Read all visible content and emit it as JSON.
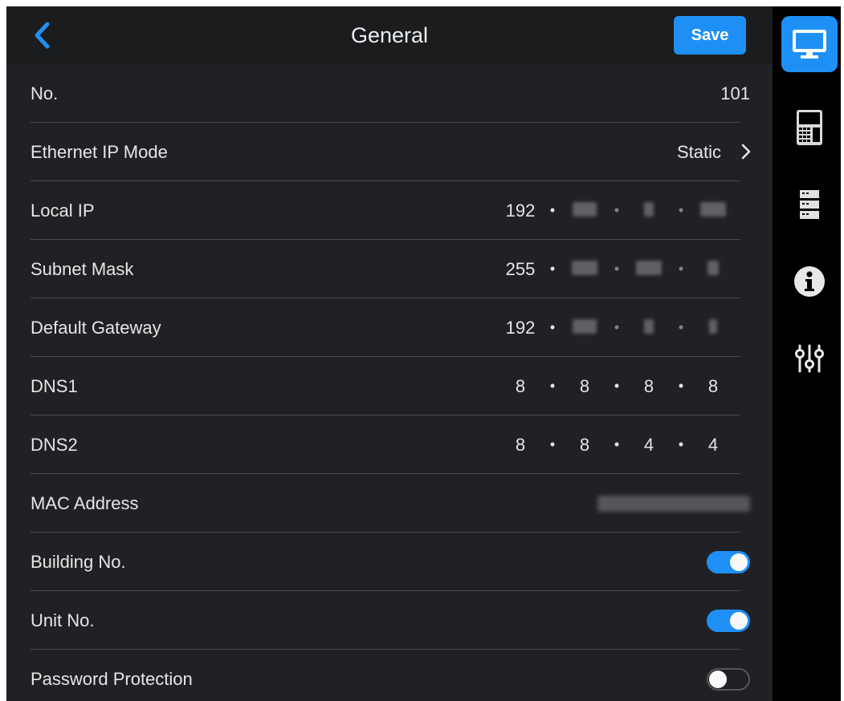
{
  "header": {
    "title": "General",
    "back_icon": "chevron-left-icon",
    "save_label": "Save"
  },
  "rows": {
    "number": {
      "label": "No.",
      "value": "101"
    },
    "ip_mode": {
      "label": "Ethernet IP Mode",
      "value": "Static"
    },
    "local_ip": {
      "label": "Local IP",
      "first_octet": "192"
    },
    "subnet_mask": {
      "label": "Subnet Mask",
      "first_octet": "255"
    },
    "gateway": {
      "label": "Default Gateway",
      "first_octet": "192"
    },
    "dns1": {
      "label": "DNS1",
      "octets": [
        "8",
        "8",
        "8",
        "8"
      ]
    },
    "dns2": {
      "label": "DNS2",
      "octets": [
        "8",
        "8",
        "4",
        "4"
      ]
    },
    "mac": {
      "label": "MAC Address"
    },
    "building_no": {
      "label": "Building No.",
      "enabled": true
    },
    "unit_no": {
      "label": "Unit No.",
      "enabled": true
    },
    "password": {
      "label": "Password Protection",
      "enabled": false
    }
  },
  "ip_separator": "•",
  "rail": {
    "items": [
      {
        "icon": "monitor-icon",
        "active": true
      },
      {
        "icon": "device-panel-icon",
        "active": false
      },
      {
        "icon": "server-icon",
        "active": false
      },
      {
        "icon": "info-icon",
        "active": false
      },
      {
        "icon": "sliders-icon",
        "active": false
      }
    ]
  },
  "colors": {
    "accent": "#1e90f5",
    "panel_bg": "#202124",
    "header_bg": "#1b1c1e",
    "rail_bg": "#000000",
    "text": "#e6e6e6"
  }
}
